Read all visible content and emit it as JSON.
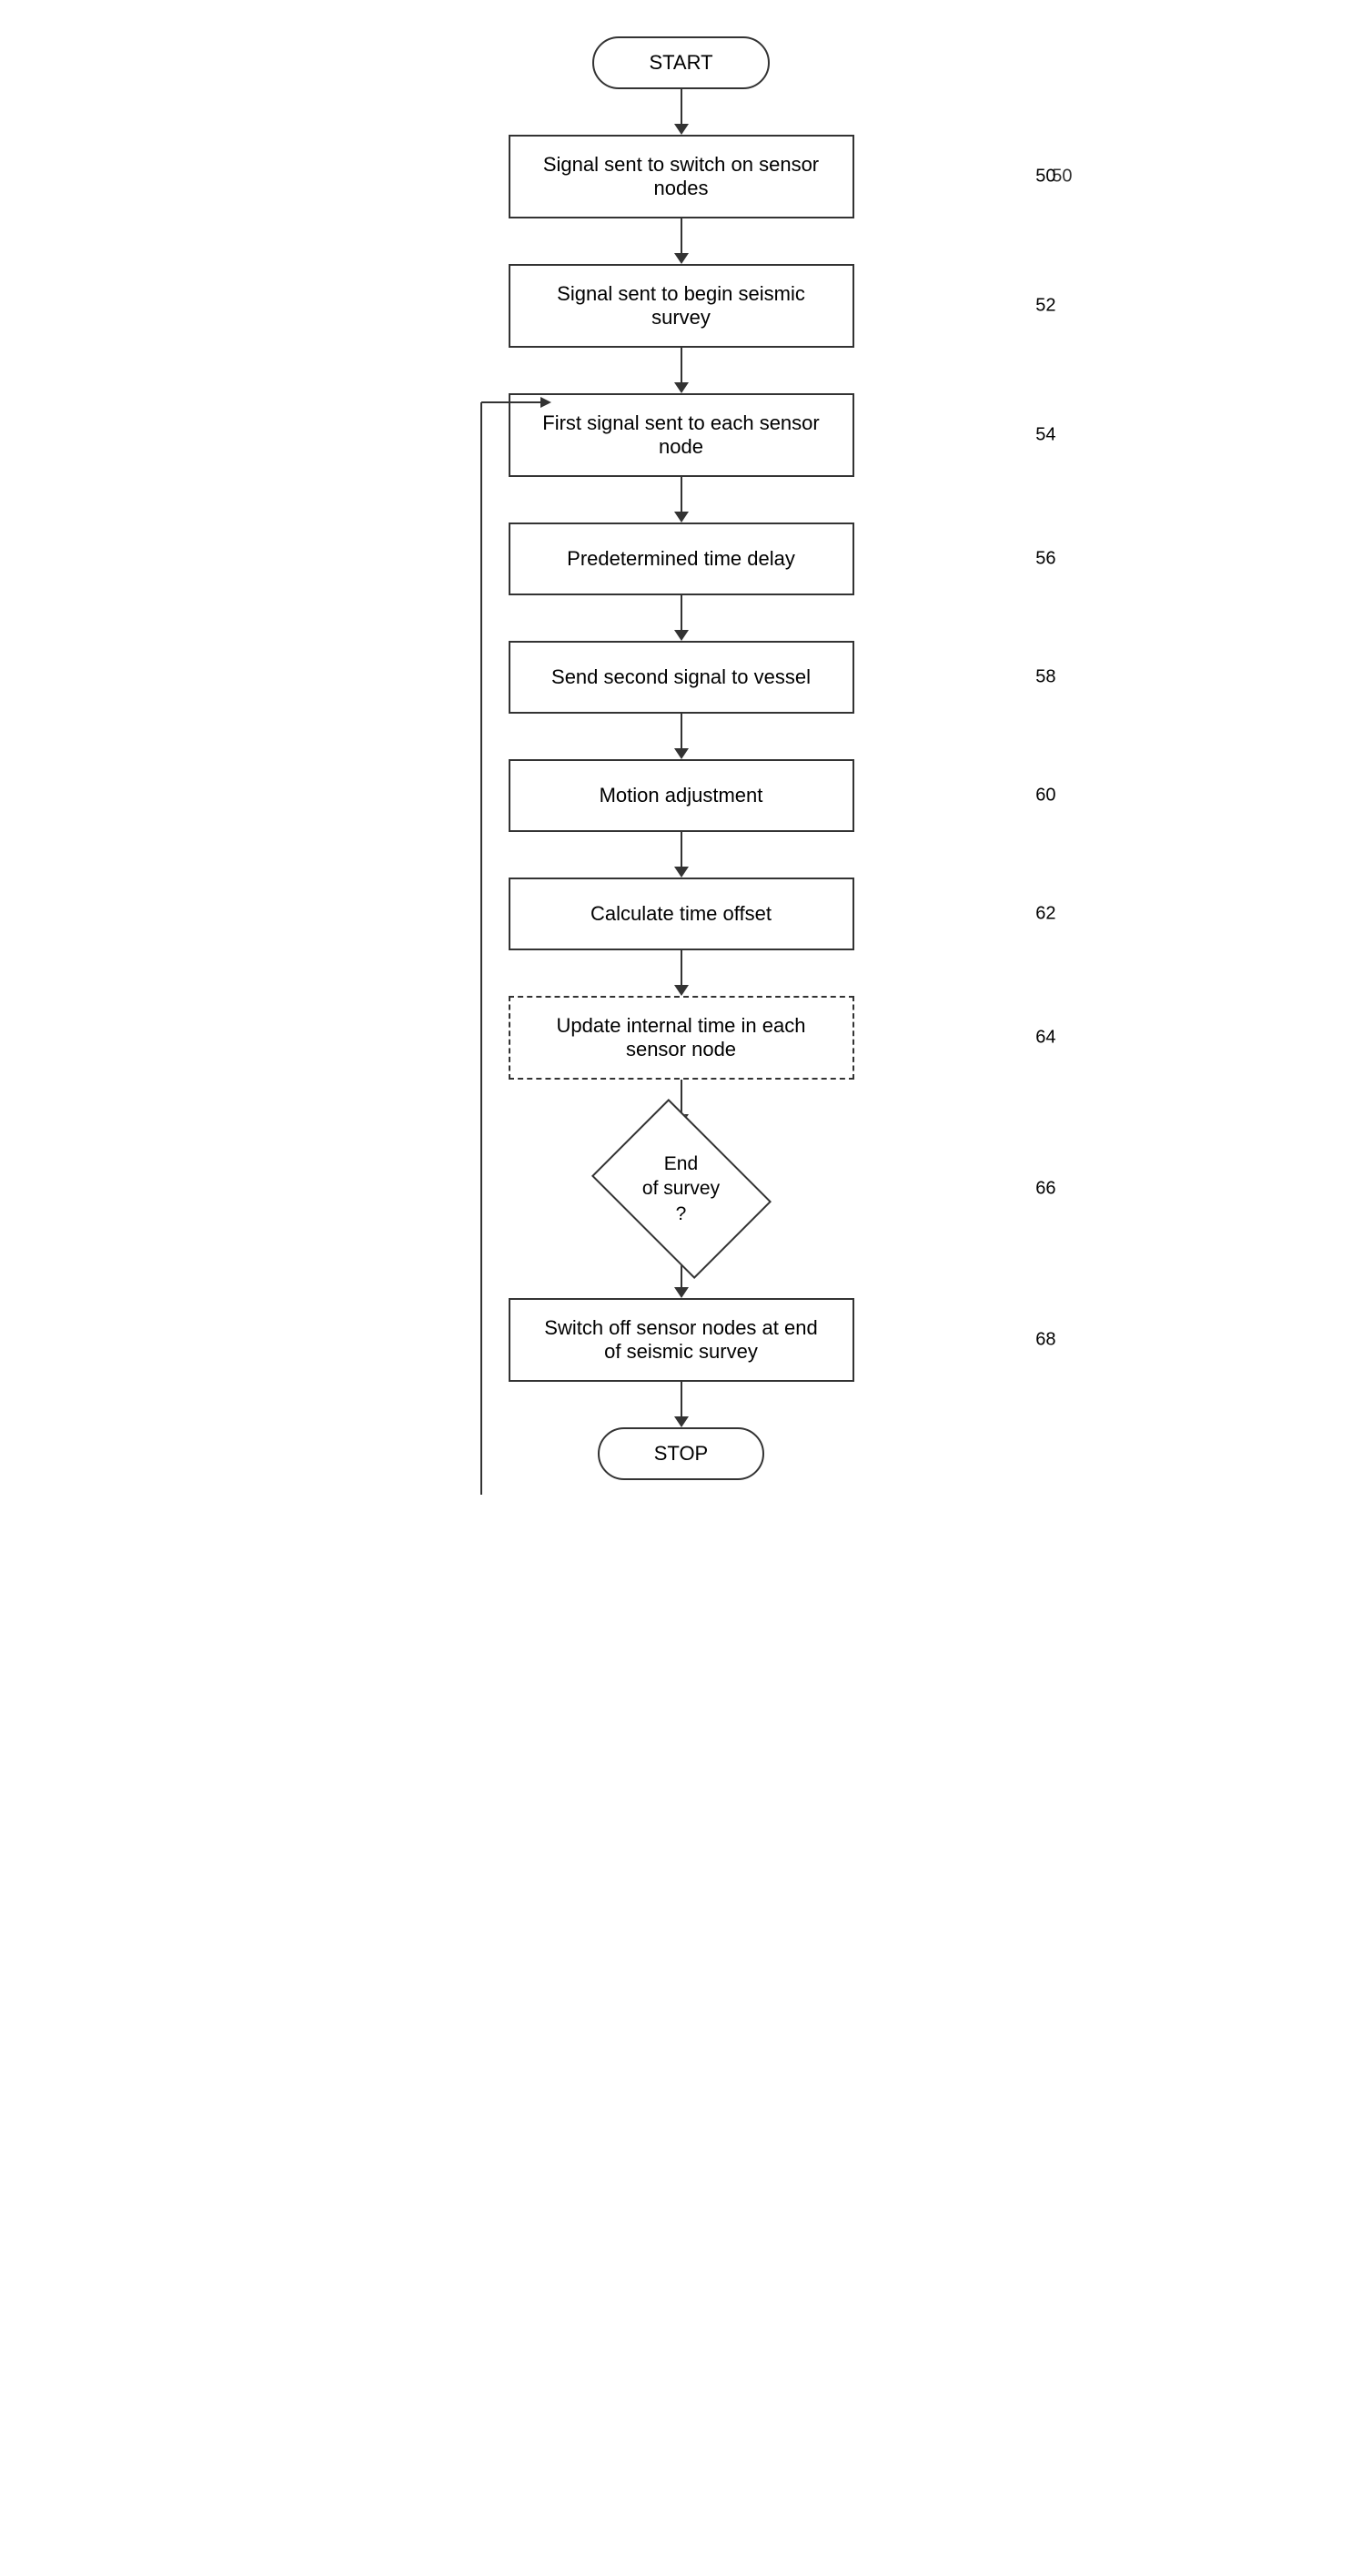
{
  "nodes": {
    "start_label": "START",
    "stop_label": "STOP",
    "box50": "Signal sent to switch on sensor nodes",
    "box52": "Signal sent to begin seismic survey",
    "box54": "First signal sent to each sensor node",
    "box56": "Predetermined time delay",
    "box58": "Send second signal to vessel",
    "box60": "Motion adjustment",
    "box62": "Calculate time offset",
    "box64": "Update internal time in each sensor node",
    "diamond66_text": "End\nof survey\n?",
    "box68": "Switch off sensor nodes at end of seismic survey"
  },
  "refs": {
    "r50": "50",
    "r52": "52",
    "r54": "54",
    "r56": "56",
    "r58": "58",
    "r60": "60",
    "r62": "62",
    "r64": "64",
    "r66": "66",
    "r68": "68"
  }
}
